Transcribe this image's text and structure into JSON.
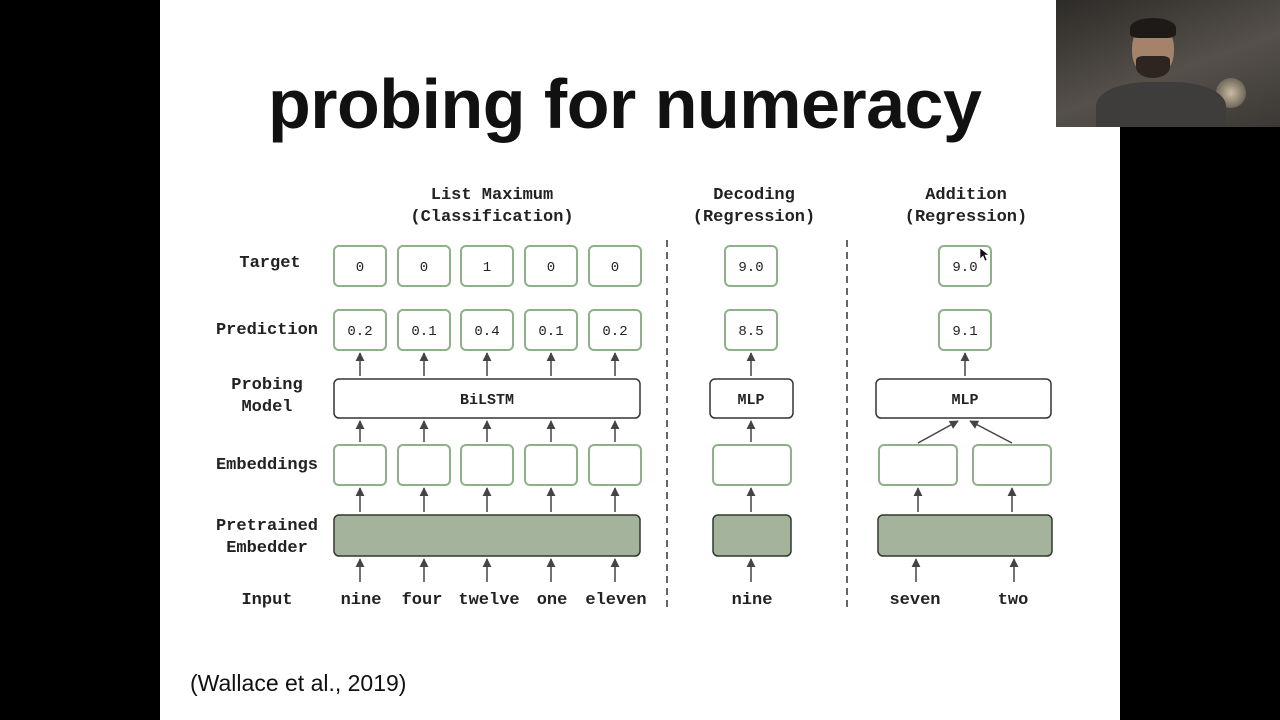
{
  "slide": {
    "title": "probing for numeracy",
    "citation": "(Wallace et al., 2019)"
  },
  "diagram": {
    "row_labels": {
      "target": "Target",
      "prediction": "Prediction",
      "probing_model_line1": "Probing",
      "probing_model_line2": "Model",
      "embeddings": "Embeddings",
      "pretrained_line1": "Pretrained",
      "pretrained_line2": "Embedder",
      "input": "Input"
    },
    "sections": {
      "list_maximum": {
        "title_line1": "List Maximum",
        "title_line2": "(Classification)",
        "targets": [
          "0",
          "0",
          "1",
          "0",
          "0"
        ],
        "predictions": [
          "0.2",
          "0.1",
          "0.4",
          "0.1",
          "0.2"
        ],
        "model": "BiLSTM",
        "inputs": [
          "nine",
          "four",
          "twelve",
          "one",
          "eleven"
        ]
      },
      "decoding": {
        "title_line1": "Decoding",
        "title_line2": "(Regression)",
        "target": "9.0",
        "prediction": "8.5",
        "model": "MLP",
        "input": "nine"
      },
      "addition": {
        "title_line1": "Addition",
        "title_line2": "(Regression)",
        "target": "9.0",
        "prediction": "9.1",
        "model": "MLP",
        "inputs": [
          "seven",
          "two"
        ]
      }
    },
    "colors": {
      "green_border": "#8fb08a",
      "embedder_fill": "#a3b39c",
      "embedder_border": "#2f3a2c",
      "arrow": "#444444"
    }
  }
}
